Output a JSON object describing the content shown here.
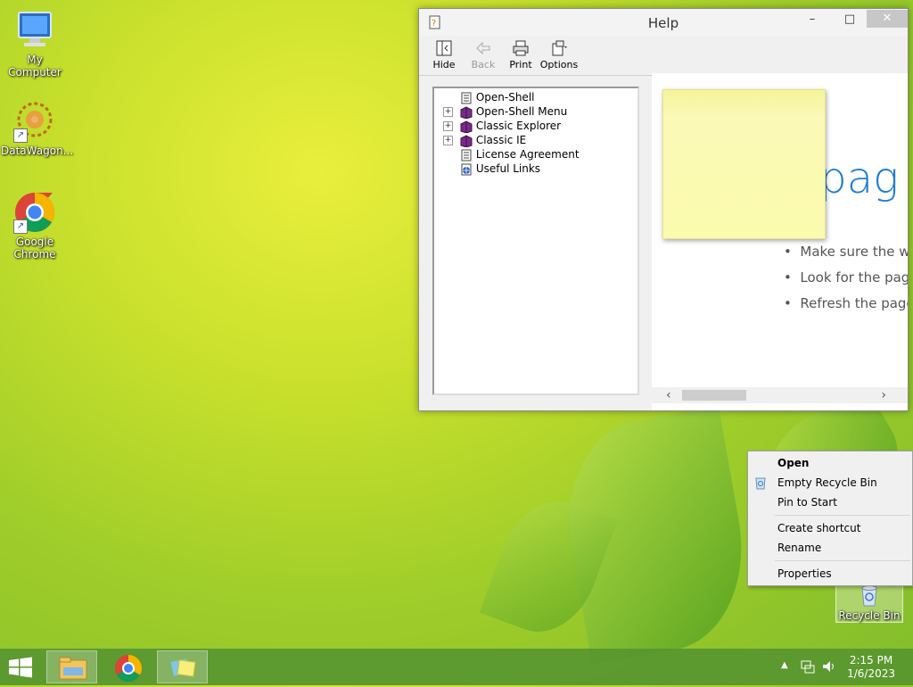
{
  "desktop": {
    "icons": [
      {
        "label": "My Computer"
      },
      {
        "label": "DataWagon..."
      },
      {
        "label": "Google Chrome"
      },
      {
        "label": "Recycle Bin"
      }
    ]
  },
  "help_window": {
    "title": "Help",
    "controls": {
      "minimize": "–",
      "maximize": "□",
      "close": "✕"
    },
    "toolbar": [
      {
        "label": "Hide",
        "enabled": true
      },
      {
        "label": "Back",
        "enabled": false
      },
      {
        "label": "Print",
        "enabled": true
      },
      {
        "label": "Options",
        "enabled": true
      }
    ],
    "tree": [
      {
        "label": "Open-Shell",
        "expandable": false,
        "icon": "page-icon"
      },
      {
        "label": "Open-Shell Menu",
        "expandable": true,
        "icon": "book-icon"
      },
      {
        "label": "Classic Explorer",
        "expandable": true,
        "icon": "book-icon"
      },
      {
        "label": "Classic IE",
        "expandable": true,
        "icon": "book-icon"
      },
      {
        "label": "License Agreement",
        "expandable": false,
        "icon": "page-icon"
      },
      {
        "label": "Useful Links",
        "expandable": false,
        "icon": "globe-page-icon"
      }
    ],
    "content": {
      "heading_fragment": "s pag",
      "bullets": [
        "Make sure the wel",
        "Look for the page",
        "Refresh the page i"
      ]
    }
  },
  "context_menu": {
    "items": [
      {
        "label": "Open",
        "bold": true
      },
      {
        "label": "Empty Recycle Bin",
        "bold": false
      },
      {
        "label": "Pin to Start",
        "bold": false
      },
      {
        "label": "Create shortcut",
        "bold": false
      },
      {
        "label": "Rename",
        "bold": false
      },
      {
        "label": "Properties",
        "bold": false
      }
    ]
  },
  "taskbar": {
    "apps": [
      "file-explorer-icon",
      "chrome-icon",
      "sticky-notes-icon"
    ],
    "tray": {
      "overflow": "▲"
    },
    "clock": {
      "time": "2:15 PM",
      "date": "1/6/2023"
    }
  },
  "colors": {
    "accent": "#1c7ed6",
    "taskbar": "#589630"
  }
}
